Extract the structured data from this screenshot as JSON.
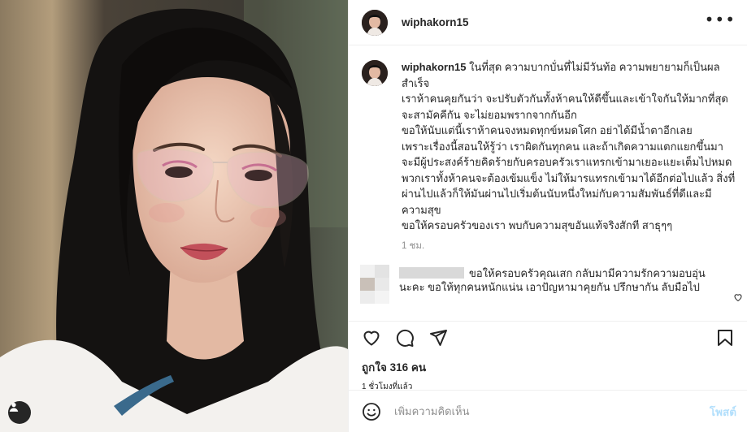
{
  "post": {
    "username": "wiphakorn15",
    "more_icon": "more-horizontal-icon"
  },
  "caption": {
    "username": "wiphakorn15",
    "lines": [
      "ในที่สุด ความบากบั่นที่ไม่มีวันท้อ ความพยายามก็เป็นผลสำเร็จ",
      "เราห้าคนคุยกันว่า จะปรับตัวกันทั้งห้าคนให้ดีขึ้นและเข้าใจกันให้มากที่สุด จะสามัคคีกัน จะไม่ยอมพรากจากกันอีก",
      "ขอให้นับแต่นี้เราห้าคนจงหมดทุกข์หมดโศก อย่าได้มีน้ำตาอีกเลย",
      "เพราะเรื่องนี้สอนให้รู้ว่า เราผิดกันทุกคน และถ้าเกิดความแตกแยกขึ้นมา จะมีผู้ประสงค์ร้ายคิดร้ายกับครอบครัวเราแทรกเข้ามาเยอะแยะเต็มไปหมด",
      "พวกเราทั้งห้าคนจะต้องเข้มแข็ง ไม่ให้มารแทรกเข้ามาได้อีกต่อไปแล้ว สิ่งที่ผ่านไปแล้วก็ให้มันผ่านไปเริ่มต้นนับหนึ่งใหม่กับความสัมพันธ์ที่ดีและมีความสุข",
      "ขอให้ครอบครัวของเรา พบกับความสุขอันแท้จริงสักที สาธุๆๆ"
    ],
    "time": "1 ชม."
  },
  "comment": {
    "text": "ขอให้ครอบครัวคุณเสก กลับมามีความรักความอบอุ่นนะคะ ขอให้ทุกคนหนักแน่น เอาปัญหามาคุยกัน ปรึกษากัน ลับมือไป"
  },
  "actions": {
    "like_icon": "heart-icon",
    "comment_icon": "comment-icon",
    "share_icon": "send-icon",
    "save_icon": "bookmark-icon",
    "likes": "ถูกใจ 316 คน",
    "posted": "1 ชั่วโมงที่แล้ว"
  },
  "add_comment": {
    "placeholder": "เพิ่มความคิดเห็น",
    "post_label": "โพสต์",
    "emoji_icon": "emoji-icon"
  },
  "colors": {
    "text": "#262626",
    "muted": "#8e8e8e",
    "post_button": "#b2dffc",
    "border": "#efefef"
  }
}
